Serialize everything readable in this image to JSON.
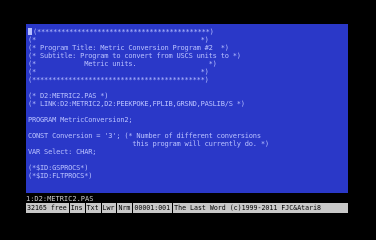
{
  "editor": {
    "lines": [
      "(*******************************************)",
      "(*                                         *)",
      "(* Program Title: Metric Conversion Program #2  *)",
      "(* Subtitle: Program to convert from USCS units to *)",
      "(*            Metric units.                  *)",
      "(*                                         *)",
      "(*******************************************)",
      "",
      "(* D2:METRIC2.PAS *)",
      "(* LINK:D2:METRIC2,D2:PEEKPOKE,FPLIB,GRSND,PASLIB/S *)",
      "",
      "PROGRAM MetricConversion2;",
      "",
      "CONST Conversion = '3'; (* Number of different conversions",
      "                          this program will currently do. *)",
      "VAR Select: CHAR;",
      "",
      "(*$ID:GSPROCS*)",
      "(*$ID:FLTPROCS*)",
      ""
    ]
  },
  "file_bar": {
    "text": "1:D2:METRIC2.PAS"
  },
  "status_bar": {
    "free": "32165 free",
    "ins": "Ins",
    "txt": "Txt",
    "lwr": "Lwr",
    "nrm": "Nrm",
    "position": "00001:001",
    "title": "The Last Word (c)1999-2011 FJC&Atari8"
  }
}
